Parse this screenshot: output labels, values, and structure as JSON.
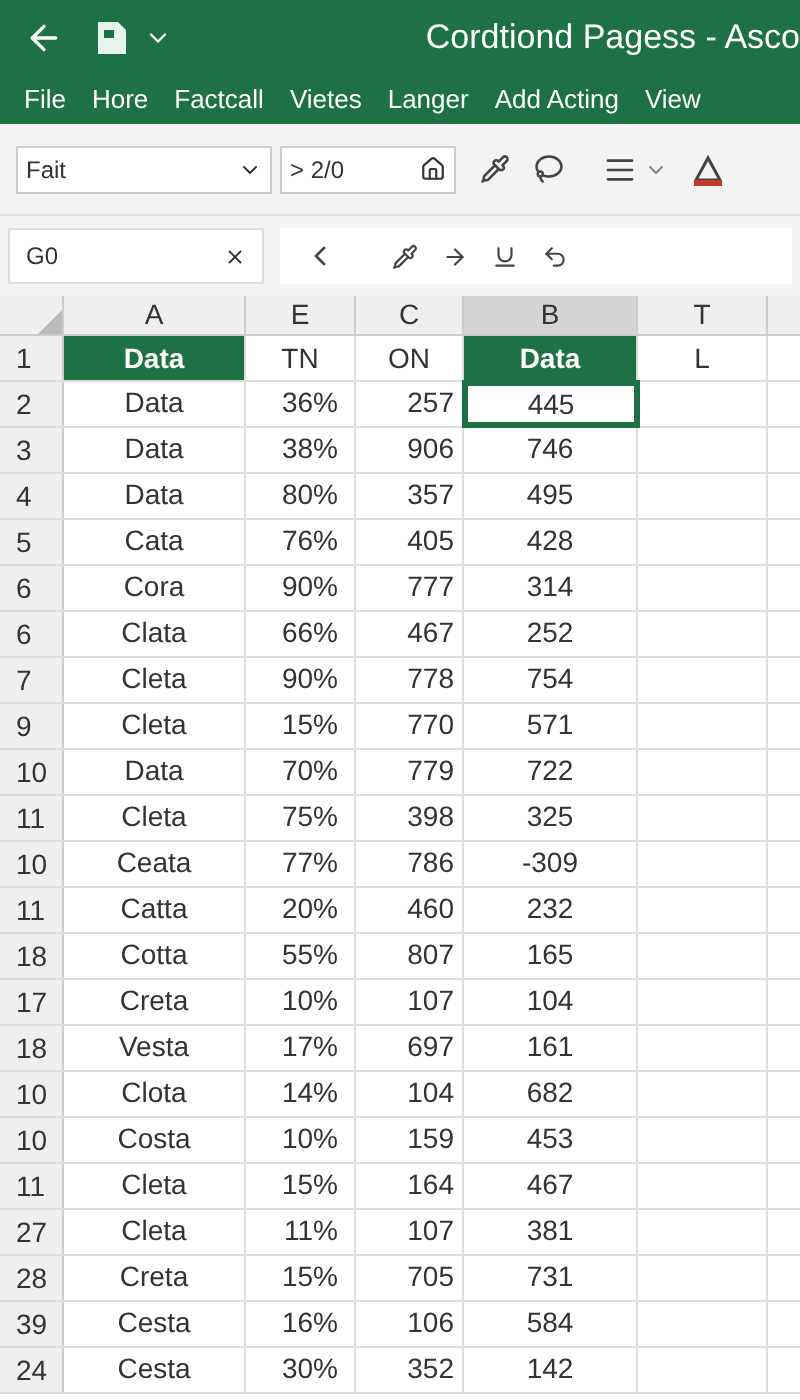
{
  "window": {
    "title": "Cordtiond Pagess - Asco"
  },
  "menu": [
    {
      "label": "File"
    },
    {
      "label": "Hore"
    },
    {
      "label": "Factcall"
    },
    {
      "label": "Vietes"
    },
    {
      "label": "Langer"
    },
    {
      "label": "Add Acting"
    },
    {
      "label": "View"
    }
  ],
  "toolbar": {
    "font": "Fait",
    "size": "> 2/0"
  },
  "formula_bar": {
    "name_box": "G0"
  },
  "columns": [
    {
      "label": "A",
      "selected": false
    },
    {
      "label": "E",
      "selected": false
    },
    {
      "label": "C",
      "selected": false
    },
    {
      "label": "B",
      "selected": true
    },
    {
      "label": "T",
      "selected": false
    }
  ],
  "header_row": {
    "num": "1",
    "cells": [
      {
        "text": "Data",
        "highlighted": true
      },
      {
        "text": "TN",
        "highlighted": false
      },
      {
        "text": "ON",
        "highlighted": false
      },
      {
        "text": "Data",
        "highlighted": true
      },
      {
        "text": "L",
        "highlighted": false
      }
    ]
  },
  "rows": [
    {
      "num": "2",
      "cells": [
        {
          "text": "Data",
          "selected": false
        },
        {
          "text": "36%",
          "selected": false
        },
        {
          "text": "257",
          "selected": false
        },
        {
          "text": "445",
          "selected": true
        }
      ]
    },
    {
      "num": "3",
      "cells": [
        {
          "text": "Data",
          "selected": false
        },
        {
          "text": "38%",
          "selected": false
        },
        {
          "text": "906",
          "selected": false
        },
        {
          "text": "746",
          "selected": false
        }
      ]
    },
    {
      "num": "4",
      "cells": [
        {
          "text": "Data",
          "selected": false
        },
        {
          "text": "80%",
          "selected": false
        },
        {
          "text": "357",
          "selected": false
        },
        {
          "text": "495",
          "selected": false
        }
      ]
    },
    {
      "num": "5",
      "cells": [
        {
          "text": "Cata",
          "selected": false
        },
        {
          "text": "76%",
          "selected": false
        },
        {
          "text": "405",
          "selected": false
        },
        {
          "text": "428",
          "selected": false
        }
      ]
    },
    {
      "num": "6",
      "cells": [
        {
          "text": "Cora",
          "selected": false
        },
        {
          "text": "90%",
          "selected": false
        },
        {
          "text": "777",
          "selected": false
        },
        {
          "text": "314",
          "selected": false
        }
      ]
    },
    {
      "num": "6",
      "cells": [
        {
          "text": "Clata",
          "selected": false
        },
        {
          "text": "66%",
          "selected": false
        },
        {
          "text": "467",
          "selected": false
        },
        {
          "text": "252",
          "selected": false
        }
      ]
    },
    {
      "num": "7",
      "cells": [
        {
          "text": "Cleta",
          "selected": false
        },
        {
          "text": "90%",
          "selected": false
        },
        {
          "text": "778",
          "selected": false
        },
        {
          "text": "754",
          "selected": false
        }
      ]
    },
    {
      "num": "9",
      "cells": [
        {
          "text": "Cleta",
          "selected": false
        },
        {
          "text": "15%",
          "selected": false
        },
        {
          "text": "770",
          "selected": false
        },
        {
          "text": "571",
          "selected": false
        }
      ]
    },
    {
      "num": "10",
      "cells": [
        {
          "text": "Data",
          "selected": false
        },
        {
          "text": "70%",
          "selected": false
        },
        {
          "text": "779",
          "selected": false
        },
        {
          "text": "722",
          "selected": false
        }
      ]
    },
    {
      "num": "11",
      "cells": [
        {
          "text": "Cleta",
          "selected": false
        },
        {
          "text": "75%",
          "selected": false
        },
        {
          "text": "398",
          "selected": false
        },
        {
          "text": "325",
          "selected": false
        }
      ]
    },
    {
      "num": "10",
      "cells": [
        {
          "text": "Ceata",
          "selected": false
        },
        {
          "text": "77%",
          "selected": false
        },
        {
          "text": "786",
          "selected": false
        },
        {
          "text": "-309",
          "selected": false
        }
      ]
    },
    {
      "num": "11",
      "cells": [
        {
          "text": "Catta",
          "selected": false
        },
        {
          "text": "20%",
          "selected": false
        },
        {
          "text": "460",
          "selected": false
        },
        {
          "text": "232",
          "selected": false
        }
      ]
    },
    {
      "num": "18",
      "cells": [
        {
          "text": "Cotta",
          "selected": false
        },
        {
          "text": "55%",
          "selected": false
        },
        {
          "text": "807",
          "selected": false
        },
        {
          "text": "165",
          "selected": false
        }
      ]
    },
    {
      "num": "17",
      "cells": [
        {
          "text": "Creta",
          "selected": false
        },
        {
          "text": "10%",
          "selected": false
        },
        {
          "text": "107",
          "selected": false
        },
        {
          "text": "104",
          "selected": false
        }
      ]
    },
    {
      "num": "18",
      "cells": [
        {
          "text": "Vesta",
          "selected": false
        },
        {
          "text": "17%",
          "selected": false
        },
        {
          "text": "697",
          "selected": false
        },
        {
          "text": "161",
          "selected": false
        }
      ]
    },
    {
      "num": "10",
      "cells": [
        {
          "text": "Clota",
          "selected": false
        },
        {
          "text": "14%",
          "selected": false
        },
        {
          "text": "104",
          "selected": false
        },
        {
          "text": "682",
          "selected": false
        }
      ]
    },
    {
      "num": "10",
      "cells": [
        {
          "text": "Costa",
          "selected": false
        },
        {
          "text": "10%",
          "selected": false
        },
        {
          "text": "159",
          "selected": false
        },
        {
          "text": "453",
          "selected": false
        }
      ]
    },
    {
      "num": "11",
      "cells": [
        {
          "text": "Cleta",
          "selected": false
        },
        {
          "text": "15%",
          "selected": false
        },
        {
          "text": "164",
          "selected": false
        },
        {
          "text": "467",
          "selected": false
        }
      ]
    },
    {
      "num": "27",
      "cells": [
        {
          "text": "Cleta",
          "selected": false
        },
        {
          "text": "11%",
          "selected": false
        },
        {
          "text": "107",
          "selected": false
        },
        {
          "text": "381",
          "selected": false
        }
      ]
    },
    {
      "num": "28",
      "cells": [
        {
          "text": "Creta",
          "selected": false
        },
        {
          "text": "15%",
          "selected": false
        },
        {
          "text": "705",
          "selected": false
        },
        {
          "text": "731",
          "selected": false
        }
      ]
    },
    {
      "num": "39",
      "cells": [
        {
          "text": "Cesta",
          "selected": false
        },
        {
          "text": "16%",
          "selected": false
        },
        {
          "text": "106",
          "selected": false
        },
        {
          "text": "584",
          "selected": false
        }
      ]
    },
    {
      "num": "24",
      "cells": [
        {
          "text": "Cesta",
          "selected": false
        },
        {
          "text": "30%",
          "selected": false
        },
        {
          "text": "352",
          "selected": false
        },
        {
          "text": "142",
          "selected": false
        }
      ]
    }
  ]
}
